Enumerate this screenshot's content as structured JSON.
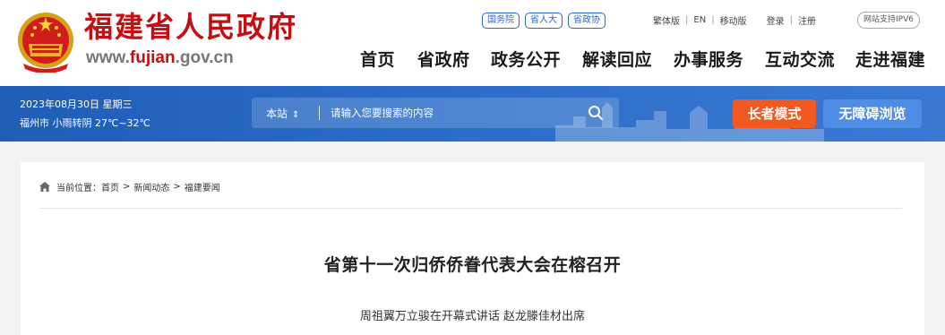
{
  "header": {
    "site_name": "福建省人民政府",
    "url_prefix": "www.",
    "url_highlight": "fujian",
    "url_suffix": ".gov.cn",
    "orgs": [
      "国务院",
      "省人大",
      "省政协"
    ],
    "top_links": [
      "繁体版",
      "EN",
      "移动版",
      "登录",
      "注册"
    ],
    "ipv6": "网站支持IPV6",
    "nav": [
      "首页",
      "省政府",
      "政务公开",
      "解读回应",
      "办事服务",
      "互动交流",
      "走进福建"
    ]
  },
  "bar": {
    "date": "2023年08月30日 星期三",
    "weather": "福州市 小雨转阴 27℃~32℃",
    "search_scope": "本站",
    "search_placeholder": "请输入您要搜索的内容",
    "elder_mode": "长者模式",
    "accessibility": "无障碍浏览"
  },
  "content": {
    "breadcrumb": [
      "当前位置：首页",
      "新闻动态",
      "福建要闻"
    ],
    "title": "省第十一次归侨侨眷代表大会在榕召开",
    "subtitle": "周祖翼万立骏在开幕式讲话 赵龙滕佳材出席"
  },
  "colors": {
    "brand_red": "#c40f12",
    "bar_blue": "#2a6cc8",
    "elder_orange": "#f05a21",
    "access_blue": "#4e8ce6"
  },
  "icons": [
    "national-emblem-icon",
    "search-icon",
    "home-icon",
    "sort-arrows-icon"
  ]
}
